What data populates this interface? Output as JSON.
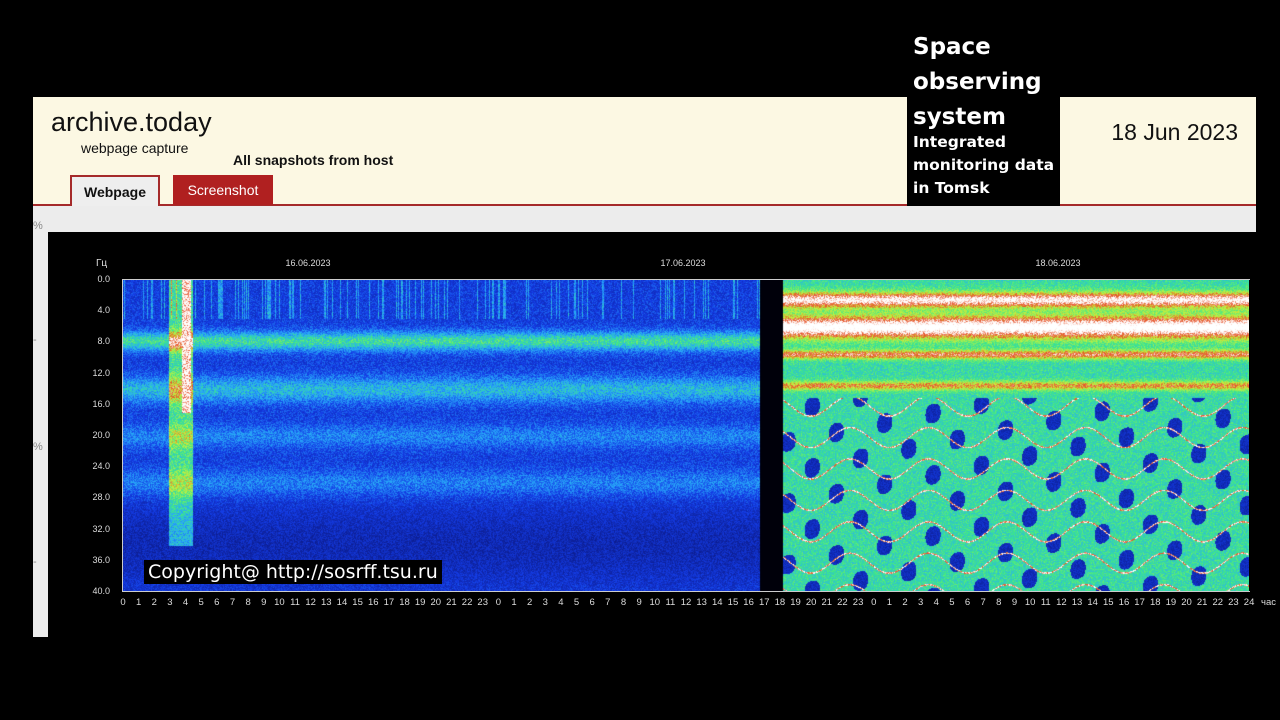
{
  "header": {
    "brand": "archive.today",
    "subtitle": "webpage capture",
    "snapshots_link": "All snapshots  from host",
    "tabs": [
      {
        "label": "Webpage",
        "active": true
      },
      {
        "label": "Screenshot",
        "active": false
      }
    ],
    "date": "18 Jun 2023",
    "accent_color": "#a52a2a"
  },
  "overlay": {
    "title": "Space observing system",
    "subtitle": "Integrated monitoring data in Tomsk"
  },
  "left_markers": [
    "%",
    "-",
    "%",
    "-"
  ],
  "spectrogram": {
    "y_unit": "Гц",
    "y_ticks": [
      "0.0",
      "4.0",
      "8.0",
      "12.0",
      "16.0",
      "20.0",
      "24.0",
      "28.0",
      "32.0",
      "36.0",
      "40.0"
    ],
    "dates": [
      "16.06.2023",
      "17.06.2023",
      "18.06.2023"
    ],
    "x_ticks": [
      "0",
      "1",
      "2",
      "3",
      "4",
      "5",
      "6",
      "7",
      "8",
      "9",
      "10",
      "11",
      "12",
      "13",
      "14",
      "15",
      "16",
      "17",
      "18",
      "19",
      "20",
      "21",
      "22",
      "23",
      "0",
      "1",
      "2",
      "3",
      "4",
      "5",
      "6",
      "7",
      "8",
      "9",
      "10",
      "11",
      "12",
      "13",
      "14",
      "15",
      "16",
      "17",
      "18",
      "19",
      "20",
      "21",
      "22",
      "23",
      "0",
      "1",
      "2",
      "3",
      "4",
      "5",
      "6",
      "7",
      "8",
      "9",
      "10",
      "11",
      "12",
      "13",
      "14",
      "15",
      "16",
      "17",
      "18",
      "19",
      "20",
      "21",
      "22",
      "23",
      "24"
    ],
    "x_unit": "час",
    "copyright": "Copyright@ http://sosrff.tsu.ru"
  }
}
